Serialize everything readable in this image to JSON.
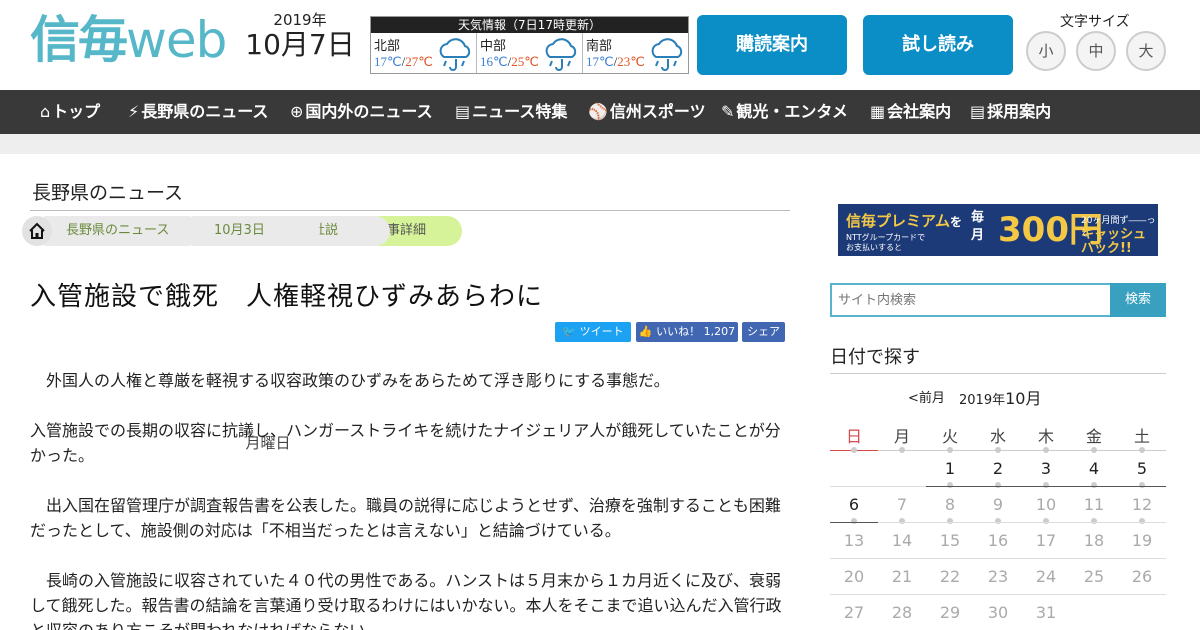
{
  "header": {
    "logo_main": "信毎",
    "logo_sub": "web",
    "date": {
      "year": "2019年",
      "month_day": "10月7日",
      "weekday": "月曜日"
    },
    "weather": {
      "title": "天気情報（7日17時更新）",
      "regions": [
        {
          "name": "北部",
          "low": "17℃",
          "sep": "/",
          "high": "27℃",
          "icon": "cloud-rain-icon"
        },
        {
          "name": "中部",
          "low": "16℃",
          "sep": "/",
          "high": "25℃",
          "icon": "cloud-rain-icon"
        },
        {
          "name": "南部",
          "low": "17℃",
          "sep": "/",
          "high": "23℃",
          "icon": "cloud-rain-icon"
        }
      ]
    },
    "subscribe_label": "購読案内",
    "trial_label": "試し読み",
    "font_size": {
      "label": "文字サイズ",
      "small": "小",
      "medium": "中",
      "large": "大"
    }
  },
  "nav": [
    {
      "icon": "⌂",
      "label": "トップ"
    },
    {
      "icon": "⚡",
      "label": "長野県のニュース"
    },
    {
      "icon": "⊕",
      "label": "国内外のニュース"
    },
    {
      "icon": "▤",
      "label": "ニュース特集"
    },
    {
      "icon": "⚾",
      "label": "信州スポーツ"
    },
    {
      "icon": "✎",
      "label": "観光・エンタメ"
    },
    {
      "icon": "▦",
      "label": "会社案内"
    },
    {
      "icon": "▤",
      "label": "採用案内"
    }
  ],
  "main": {
    "section_title": "長野県のニュース",
    "breadcrumb": [
      "長野県のニュース",
      "10月3日",
      "社説",
      "記事詳細"
    ],
    "title": "入管施設で餓死　人権軽視ひずみあらわに",
    "social": {
      "tweet": "ツイート",
      "like": "いいね！",
      "like_count": "1,207",
      "share": "シェア"
    },
    "paragraphs": [
      "　外国人の人権と尊厳を軽視する収容政策のひずみをあらためて浮き彫りにする事態だ。",
      "入管施設での長期の収容に抗議し、ハンガーストライキを続けたナイジェリア人が餓死していたことが分かった。",
      "　出入国在留管理庁が調査報告書を公表した。職員の説得に応じようとせず、治療を強制することも困難だったとして、施設側の対応は「不相当だったとは言えない」と結論づけている。",
      "　長崎の入管施設に収容されていた４０代の男性である。ハンストは５月末から１カ月近くに及び、衰弱して餓死した。報告書の結論を言葉通り受け取るわけにはいかない。本人をそこまで追い込んだ入管行政と収容のあり方こそが問われなければならない。"
    ]
  },
  "sidebar": {
    "banner": {
      "brand": "信毎プレミアム",
      "particle": "を",
      "card_text_1": "NTTグループカードで",
      "card_text_2": "お支払いすると",
      "monthly": "毎月",
      "amount": "300円",
      "months_note": "20ヶ月間ず――っと",
      "cashback": "キャッシュバック!!"
    },
    "search": {
      "placeholder": "サイト内検索",
      "button": "検索"
    },
    "calendar": {
      "title": "日付で探す",
      "prev": "<前月",
      "year": "2019年",
      "month": "10月",
      "weekdays": [
        "日",
        "月",
        "火",
        "水",
        "木",
        "金",
        "土"
      ],
      "weeks": [
        [
          "",
          "",
          "1",
          "2",
          "3",
          "4",
          "5"
        ],
        [
          "6",
          "7",
          "8",
          "9",
          "10",
          "11",
          "12"
        ],
        [
          "13",
          "14",
          "15",
          "16",
          "17",
          "18",
          "19"
        ],
        [
          "20",
          "21",
          "22",
          "23",
          "24",
          "25",
          "26"
        ],
        [
          "27",
          "28",
          "29",
          "30",
          "31",
          "",
          ""
        ]
      ],
      "days_with_articles": [
        "1",
        "2",
        "3",
        "4",
        "5",
        "6"
      ]
    }
  },
  "colors": {
    "logo": "#55b7c8",
    "header_button": "#0b8dc6",
    "nav_bg": "#393939",
    "breadcrumb_active": "#d6f39a",
    "tweet": "#1da1f2",
    "facebook": "#4267b2",
    "temp_low": "#3a7fd4",
    "temp_high": "#e0552a",
    "sunday": "#d74a4a"
  }
}
